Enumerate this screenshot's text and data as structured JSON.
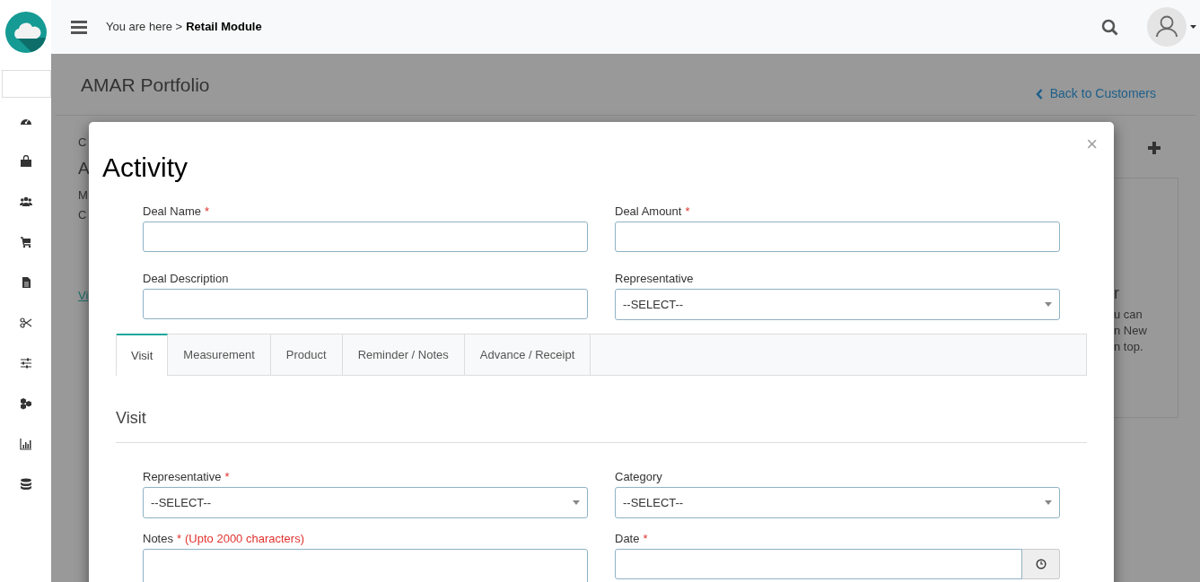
{
  "header": {
    "breadcrumb_prefix": "You are here >",
    "breadcrumb_current": "Retail Module"
  },
  "page": {
    "title": "AMAR Portfolio",
    "back_link": "Back to Customers",
    "left_fragments": [
      "C",
      "A",
      "M",
      "C"
    ],
    "link_fragment": "Vi",
    "right_fragments": [
      "r",
      "u can",
      "n New",
      "n top."
    ]
  },
  "modal": {
    "title": "Activity",
    "close": "×",
    "fields": [
      {
        "label": "Deal Name",
        "required_mark": "*",
        "kind": "input"
      },
      {
        "label": "Deal Amount",
        "required_mark": "*",
        "kind": "input"
      },
      {
        "label": "Deal Description",
        "kind": "input"
      },
      {
        "label": "Representative",
        "kind": "select",
        "value": "--SELECT--"
      }
    ],
    "tabs": [
      {
        "label": "Visit",
        "selected": true
      },
      {
        "label": "Measurement",
        "selected": false
      },
      {
        "label": "Product",
        "selected": false
      },
      {
        "label": "Reminder / Notes",
        "selected": false
      },
      {
        "label": "Advance / Receipt",
        "selected": false
      }
    ],
    "section_title": "Visit",
    "visit_fields": [
      {
        "label": "Representative",
        "required_mark": "*",
        "kind": "select",
        "value": "--SELECT--"
      },
      {
        "label": "Category",
        "kind": "select",
        "value": "--SELECT--"
      },
      {
        "label": "Notes",
        "required_mark": "*",
        "hint": "(Upto 2000 characters)",
        "kind": "textarea"
      },
      {
        "label": "Date",
        "required_mark": "*",
        "kind": "date"
      }
    ]
  }
}
